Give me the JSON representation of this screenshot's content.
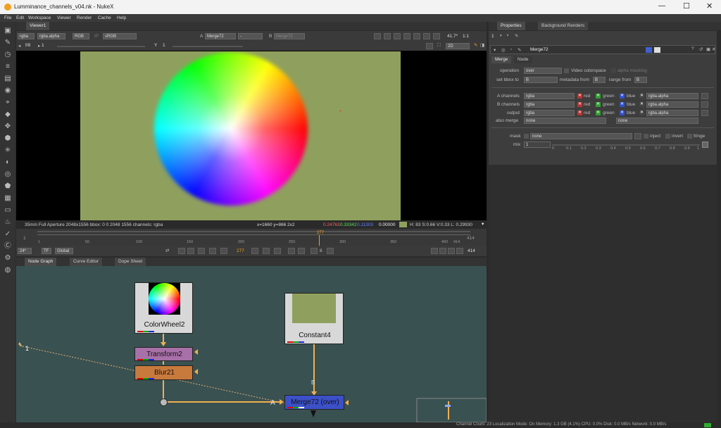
{
  "window": {
    "title": "Lumminance_channels_v04.nk - NukeX",
    "icon": "nuke-logo-icon",
    "controls": [
      "minimize",
      "maximize",
      "close"
    ]
  },
  "menu": [
    "File",
    "Edit",
    "Workspace",
    "Viewer",
    "Render",
    "Cache",
    "Help"
  ],
  "viewer": {
    "tab": "Viewer1",
    "channels": "rgba",
    "channel_alpha": "rgba.alpha",
    "display": "RGB",
    "colorspace_label": "IP",
    "colorspace": "sRGB",
    "input_a_label": "A",
    "input_a": "Merge72",
    "wipe": "-",
    "input_b_label": "B",
    "input_b": "Merge72",
    "zoom": "41.7*",
    "ratio": "1:1",
    "fstop": "f/8",
    "frame_step": "1",
    "y_label": "Y",
    "y_value": "1",
    "view_mode": "2D",
    "info_left": "35mm Full Aperture 2048x1556  bbox: 0 0 2048 1556 channels: rgba",
    "coords": "x=1660 y=866 2x2",
    "pixel_r": "0.24763",
    "pixel_g": "0.33342",
    "pixel_b": "0.11303",
    "pixel_a": "0.00000",
    "hsv": "H: 83 S:0.66 V:0.33  L: 0.29930"
  },
  "timeline": {
    "start": "1",
    "end": "414",
    "current": "277",
    "end_label": "414",
    "ticks": [
      "1",
      "50",
      "100",
      "150",
      "200",
      "250",
      "300",
      "350",
      "400",
      "414"
    ]
  },
  "playback": {
    "fps": "24*",
    "tf": "TF",
    "scope": "Global",
    "current": "277",
    "step": "8",
    "end": "414"
  },
  "graph_tabs": [
    "Node Graph",
    "Curve Editor",
    "Dope Sheet"
  ],
  "nodes": {
    "colorwheel": "ColorWheel2",
    "transform": "Transform2",
    "blur": "Blur21",
    "constant": "Constant4",
    "merge": "Merge72 (over)",
    "input_a": "A",
    "input_b": "B",
    "backdrop_label": "1"
  },
  "properties": {
    "tabs": [
      "Properties",
      "Background Renders"
    ],
    "max_panels": "1",
    "node_name": "Merge72",
    "subtabs": [
      "Merge",
      "Node"
    ],
    "operation_label": "operation",
    "operation": "over",
    "video_colorspace": "Video colorspace",
    "alpha_masking": "alpha masking",
    "bbox_label": "set bbox to",
    "bbox": "B",
    "metadata_label": "metadata from",
    "metadata": "B",
    "range_label": "range from",
    "range": "B",
    "a_channels_label": "A channels",
    "a_channels": "rgba",
    "b_channels_label": "B channels",
    "b_channels": "rgba",
    "output_label": "output",
    "output": "rgba",
    "red": "red",
    "green": "green",
    "blue": "blue",
    "alpha_ch": "rgba.alpha",
    "also_merge_label": "also merge",
    "also_merge": "none",
    "also_merge2": "none",
    "mask_label": "mask",
    "mask": "none",
    "inject": "inject",
    "invert": "invert",
    "fringe": "fringe",
    "mix_label": "mix",
    "mix": "1",
    "mix_ticks": [
      "0",
      "0.1",
      "0.2",
      "0.3",
      "0.4",
      "0.5",
      "0.6",
      "0.7",
      "0.8",
      "0.9",
      "1"
    ]
  },
  "status": "Channel Count: 23  Localization Mode: On  Memory: 1.3 GB (4.1%)  CPU: 0.0%  Disk: 0.0 MB/s  Network: 0.0 MB/s",
  "colors": {
    "bg_frame": "#8fa05e",
    "node_graph_bg": "#3a5151",
    "transform": "#a870a8",
    "blur": "#c87a3c",
    "merge": "#3c50c8",
    "pipe": "#f0b050"
  }
}
